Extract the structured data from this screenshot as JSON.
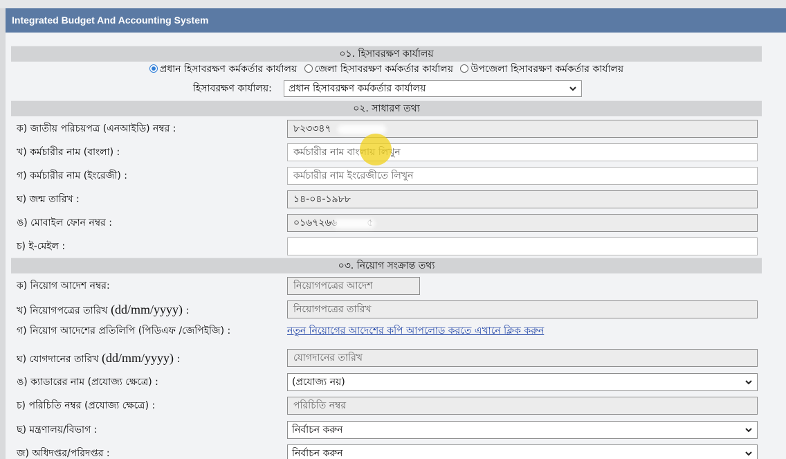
{
  "app": {
    "title": "Integrated Budget And Accounting System"
  },
  "section1": {
    "heading": "০১. হিসাবরক্ষণ কার্যালয়",
    "radios": [
      {
        "label": "প্রধান হিসাবরক্ষণ কর্মকর্তার কার্যালয়",
        "checked": true
      },
      {
        "label": "জেলা হিসাবরক্ষণ কর্মকর্তার কার্যালয়",
        "checked": false
      },
      {
        "label": "উপজেলা হিসাবরক্ষণ কর্মকর্তার কার্যালয়",
        "checked": false
      }
    ],
    "office_label": "হিসাবরক্ষণ কার্যালয়:",
    "office_value": "প্রধান হিসাবরক্ষণ কর্মকর্তার কার্যালয়"
  },
  "section2": {
    "heading": "০২. সাধারণ তথ্য",
    "nid_label": "ক) জাতীয় পরিচয়পত্র (এনআইডি) নম্বর :",
    "nid_value": "৮২৩৩৪৭",
    "name_bn_label": "খ) কর্মচারীর নাম (বাংলা) :",
    "name_bn_placeholder": "কর্মচারীর নাম বাংলায় লিখুন",
    "name_en_label": "গ) কর্মচারীর নাম (ইংরেজী) :",
    "name_en_placeholder": "কর্মচারীর নাম ইংরেজীতে লিখুন",
    "dob_label": "ঘ) জন্ম তারিখ :",
    "dob_value": "১৪-০৪-১৯৮৮",
    "mobile_label": "ঙ) মোবাইল ফোন নম্বর :",
    "mobile_value": "০১৬৭২৬৬",
    "mobile_tail": "৫",
    "email_label": "চ) ই-মেইল :",
    "email_value": ""
  },
  "section3": {
    "heading": "০৩. নিয়োগ সংক্রান্ত তথ্য",
    "order_no_label": "ক) নিয়োগ আদেশ নম্বর:",
    "order_no_placeholder": "নিয়োগপত্রের আদেশ",
    "order_date_label_a": "খ) নিয়োগপত্রের তারিখ ",
    "order_date_label_b": "(dd/mm/yyyy)",
    "order_date_label_c": " :",
    "order_date_placeholder": "নিয়োগপত্রের তারিখ",
    "copy_label": "গ) নিয়োগ আদেশের প্রতিলিপি (পিডিএফ /জেপিইজি) :",
    "copy_link": "নতুন নিয়োগের আদেশের কপি আপলোড করতে এখানে ক্লিক করুন",
    "join_date_label_a": "ঘ) যোগদানের তারিখ ",
    "join_date_label_b": "(dd/mm/yyyy)",
    "join_date_label_c": " :",
    "join_date_placeholder": "যোগদানের তারিখ",
    "cadre_label": "ঙ) ক্যাডারের নাম (প্রযোজ্য ক্ষেত্রে) :",
    "cadre_value": "(প্রযোজ্য নয়)",
    "id_label": "চ) পরিচিতি নম্বর (প্রযোজ্য ক্ষেত্রে) :",
    "id_placeholder": "পরিচিতি নম্বর",
    "ministry_label": "ছ) মন্ত্রণালয়/বিভাগ :",
    "ministry_value": "নির্বাচন করুন",
    "directorate_label": "জ) অধিদপ্তর/পরিদপ্তর :",
    "directorate_value": "নির্বাচন করুন"
  }
}
